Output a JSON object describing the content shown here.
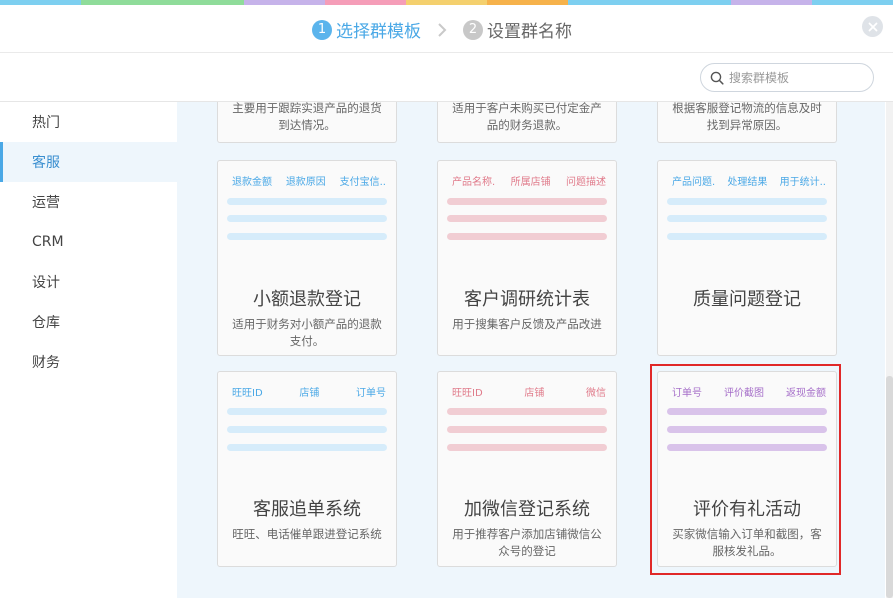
{
  "strip_colors": [
    "#7dcff0",
    "#8fdc9a",
    "#8fdc9a",
    "#c6b3ea",
    "#f59db8",
    "#f4d06e",
    "#f6b24b",
    "#7dcff0",
    "#7dcff0",
    "#c6b3ea",
    "#7dcff0"
  ],
  "steps": [
    {
      "num": "1",
      "label": "选择群模板",
      "state": "active"
    },
    {
      "num": "2",
      "label": "设置群名称",
      "state": "inactive"
    }
  ],
  "search": {
    "placeholder": "搜索群模板",
    "value": ""
  },
  "sidebar": {
    "items": [
      {
        "label": "热门",
        "active": false
      },
      {
        "label": "客服",
        "active": true
      },
      {
        "label": "运营",
        "active": false
      },
      {
        "label": "CRM",
        "active": false
      },
      {
        "label": "设计",
        "active": false
      },
      {
        "label": "仓库",
        "active": false
      },
      {
        "label": "财务",
        "active": false
      }
    ]
  },
  "top_cards": [
    {
      "desc": "主要用于跟踪实退产品的退货到达情况。"
    },
    {
      "desc": "适用于客户未购买已付定金产品的财务退款。"
    },
    {
      "desc": "根据客服登记物流的信息及时找到异常原因。"
    }
  ],
  "cards": [
    {
      "fields": [
        "退款金额",
        "退款原因",
        "支付宝信.."
      ],
      "field_color": "#4aa8e6",
      "bar_color": "#d6ecfa",
      "title": "小额退款登记",
      "desc": "适用于财务对小额产品的退款支付。"
    },
    {
      "fields": [
        "产品名称.",
        "所属店铺",
        "问题描述"
      ],
      "field_color": "#e07a8a",
      "bar_color": "#f1cdd3",
      "title": "客户调研统计表",
      "desc": "用于搜集客户反馈及产品改进"
    },
    {
      "fields": [
        "产品问题.",
        "处理结果",
        "用于统计.."
      ],
      "field_color": "#4aa8e6",
      "bar_color": "#d6ecfa",
      "title": "质量问题登记",
      "desc": ""
    },
    {
      "fields": [
        "旺旺ID",
        "店铺",
        "订单号"
      ],
      "field_color": "#4aa8e6",
      "bar_color": "#d6ecfa",
      "title": "客服追单系统",
      "desc": "旺旺、电话催单跟进登记系统"
    },
    {
      "fields": [
        "旺旺ID",
        "店铺",
        "微信"
      ],
      "field_color": "#e07a8a",
      "bar_color": "#f1cdd3",
      "title": "加微信登记系统",
      "desc": "用于推荐客户添加店铺微信公众号的登记"
    },
    {
      "fields": [
        "订单号",
        "评价截图",
        "返现金额"
      ],
      "field_color": "#a66fc9",
      "bar_color": "#d9c3ea",
      "title": "评价有礼活动",
      "desc": "买家微信输入订单和截图，客服核发礼品。"
    }
  ],
  "icons": {
    "close": "close-icon",
    "search": "search-icon",
    "chevron": "chevron-right-icon"
  }
}
